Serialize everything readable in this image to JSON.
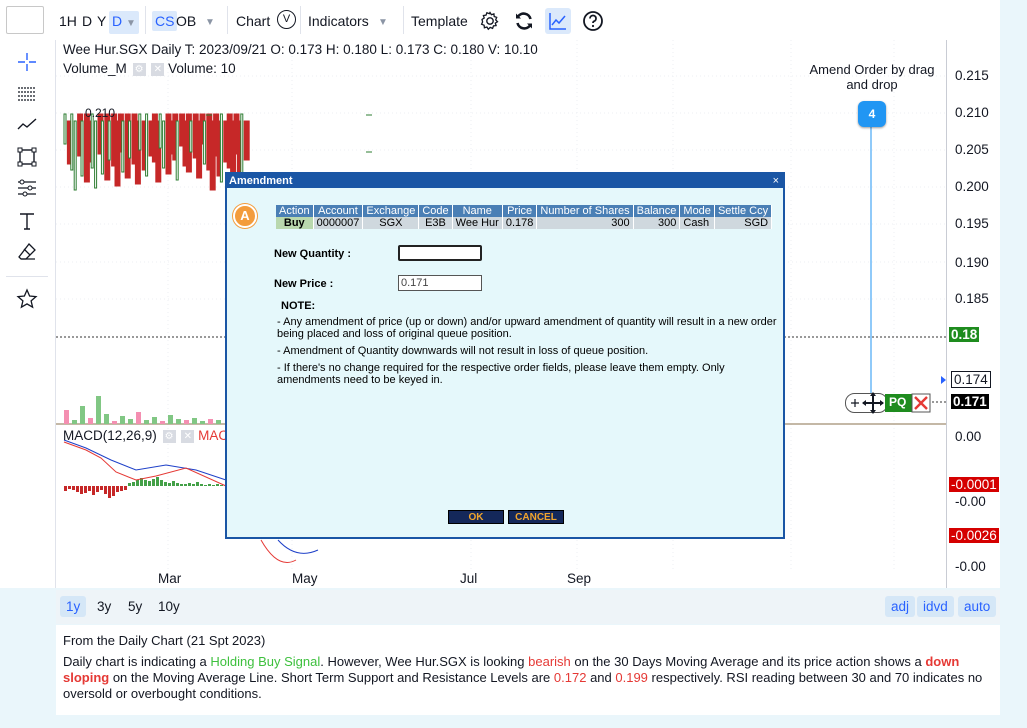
{
  "toolbar": {
    "intervals": [
      "1H",
      "D",
      "Y"
    ],
    "interval_selected": "D",
    "cs_label": "CS",
    "ob_label": "OB",
    "chart_label": "Chart",
    "chart_badge": "V",
    "indicators_label": "Indicators",
    "template_label": "Template"
  },
  "legend": {
    "main": "Wee Hur.SGX Daily   T: 2023/09/21   O: 0.173   H: 0.180   L: 0.173   C: 0.180   V: 10.10",
    "volume_name": "Volume_M",
    "volume_value": "Volume: 10",
    "macd_name": "MACD(12,26,9)",
    "macd_tail": "MAC"
  },
  "chart_labels": {
    "high_marker": "0.210"
  },
  "price_axis": {
    "ticks": [
      "0.215",
      "0.210",
      "0.205",
      "0.200",
      "0.195",
      "0.190",
      "0.185"
    ],
    "last_price": "0.18",
    "order_price_1": "0.174",
    "order_price_2": "0.171",
    "macd_ticks": [
      "0.00",
      "-0.00",
      "-0.00"
    ],
    "macd_badge_1": "-0.0001",
    "macd_badge_2": "-0.0026"
  },
  "x_axis": {
    "labels": [
      "Mar",
      "May",
      "Jul",
      "Sep"
    ]
  },
  "amend_hint": {
    "text": "Amend Order by drag and drop",
    "badge": "4"
  },
  "order_tag": {
    "label": "PQ"
  },
  "range_bar": {
    "ranges": [
      "1y",
      "3y",
      "5y",
      "10y"
    ],
    "selected": "1y",
    "adj": "adj",
    "idvd": "idvd",
    "auto": "auto"
  },
  "commentary": {
    "heading": "From the Daily Chart (21 Spt 2023)",
    "s1": "Daily chart is indicating a ",
    "signal": "Holding Buy Signal",
    "s2": ". However, Wee Hur.SGX is looking ",
    "bearish": "bearish",
    "s3": " on the 30 Days Moving Average and its price action shows a ",
    "down_sloping": "down sloping",
    "s4": " on the Moving Average Line. Short Term Support and Resistance Levels are ",
    "support": "0.172",
    "s5": " and ",
    "resistance": "0.199",
    "s6": " respectively. RSI reading between 30 and 70 indicates no oversold or overbought conditions."
  },
  "dialog": {
    "title": "Amendment",
    "close": "×",
    "logo": "A",
    "headers": [
      "Action",
      "Account",
      "Exchange",
      "Code",
      "Name",
      "Price",
      "Number of Shares",
      "Balance",
      "Mode",
      "Settle Ccy"
    ],
    "row": {
      "action": "Buy",
      "account": "0000007",
      "exchange": "SGX",
      "code": "E3B",
      "name": "Wee Hur",
      "price": "0.178",
      "shares": "300",
      "balance": "300",
      "mode": "Cash",
      "ccy": "SGD"
    },
    "qty_label": "New Quantity :",
    "qty_value": "",
    "price_label": "New Price :",
    "price_value": "0.171",
    "note_heading": "NOTE:",
    "note1": "- Any amendment of price (up or down) and/or upward amendment of quantity will result in a new order being placed and loss of original queue position.",
    "note2": "- Amendment of Quantity downwards will not result in loss of queue position.",
    "note3": "- If there's no change required for the respective order fields, please leave them empty. Only amendments need to be keyed in.",
    "ok": "OK",
    "cancel": "CANCEL"
  },
  "colors": {
    "up": "#2e7d32",
    "down": "#c62828",
    "accent": "#2962ff",
    "dialog_border": "#1a56a5"
  }
}
